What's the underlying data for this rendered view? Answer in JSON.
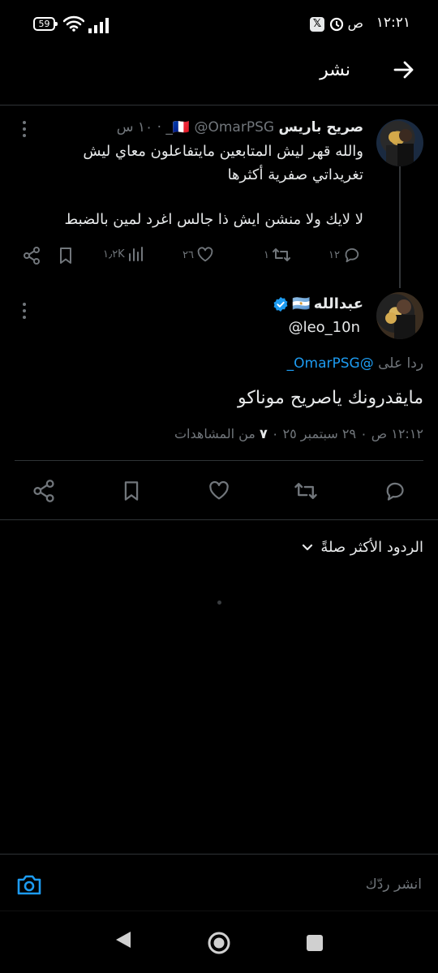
{
  "status_bar": {
    "time": "١٢:٢١",
    "ampm": "ص",
    "battery": "59",
    "icons": [
      "clock-icon",
      "x-app-icon",
      "wifi-icon",
      "signal-icon",
      "battery-icon"
    ]
  },
  "header": {
    "title": "نشر",
    "back_icon": "arrow-right-icon"
  },
  "parent_tweet": {
    "display_name": "صريح باريس",
    "flag": "🇫🇷",
    "handle": "@OmarPSG_",
    "time_ago": "١٠ س",
    "text_line1": "والله قهر ليش المتابعين مايتفاعلون معاي ليش",
    "text_line2": "تغريداتي صفرية أكثرها",
    "text_line3": "لا لايك ولا منشن ايش ذا جالس اغرد لمين بالضبط",
    "replies": "١٢",
    "retweets": "١",
    "likes": "٢٦",
    "views": "١٫٢K"
  },
  "main_tweet": {
    "display_name": "عبدالله",
    "flag": "🇦🇷",
    "handle": "@leo_10n",
    "verified": true,
    "reply_to_label": "ردا على",
    "reply_to_handle": "@OmarPSG_",
    "text": "مايقدرونك ياصريح موناكو",
    "timestamp": "١٢:١٢ ص ٠ ٢٩ سبتمبر ٢٥ ٠",
    "views_count": "٧",
    "views_label": "من المشاهدات"
  },
  "sort": {
    "label": "الردود الأكثر صلةً"
  },
  "reply_bar": {
    "placeholder": "انشر ردّك"
  },
  "colors": {
    "accent": "#1d9bf0",
    "muted": "#71767b",
    "divider": "#2f3336",
    "background": "#000000"
  }
}
